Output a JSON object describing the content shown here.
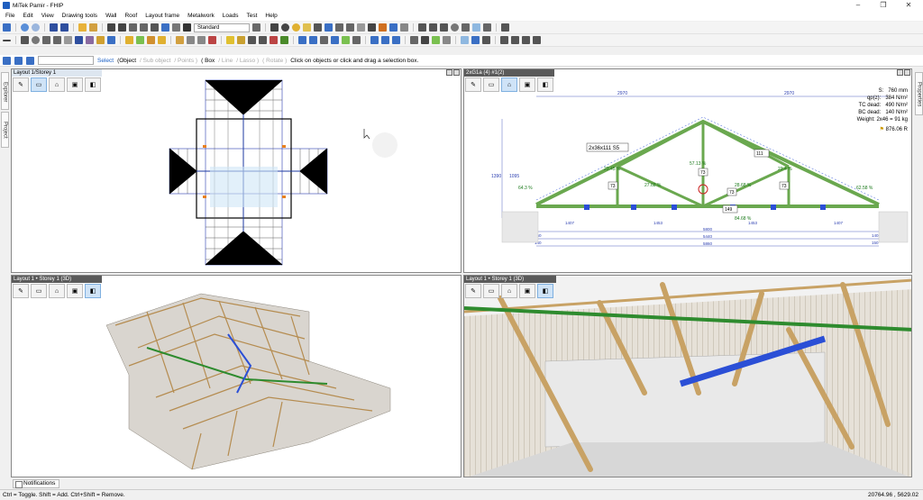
{
  "window": {
    "title": "MiTek Pamir - FHIP",
    "minimize": "–",
    "maximize": "❐",
    "close": "✕"
  },
  "menu": [
    "File",
    "Edit",
    "View",
    "Drawing tools",
    "Wall",
    "Roof",
    "Layout frame",
    "Metalwork",
    "Loads",
    "Test",
    "Help"
  ],
  "toolbar": {
    "style_dropdown": "Standard"
  },
  "selection_bar": {
    "select": "Select",
    "object": "Object",
    "sub_object": "Sub object",
    "points": "Points",
    "box": "Box",
    "line": "Line",
    "lasso": "Lasso",
    "rotate": "Rotate",
    "hint": "Click on objects or click and drag a selection box."
  },
  "side_tabs": {
    "explorer": "Explorer",
    "project": "Project",
    "properties": "Properties"
  },
  "viewports": {
    "plan": {
      "title": "Layout 1/Storey 1"
    },
    "truss": {
      "title": "2xG1a (4) #1(2)",
      "props": [
        {
          "label": "S:",
          "value": "760 mm"
        },
        {
          "label": "qp(z):",
          "value": "384 N/m²"
        },
        {
          "label": "TC dead:",
          "value": "490 N/m²"
        },
        {
          "label": "BC dead:",
          "value": "140 N/m²"
        },
        {
          "label": "Weight:",
          "value": "2x46 = 91 kg"
        }
      ],
      "price": "876.06 R",
      "member_label": "2x36x111 S5",
      "top_dims": [
        "2970",
        "2970"
      ],
      "height_dims": [
        "1390",
        "1095"
      ],
      "percentages": [
        "64.3 %",
        "23.45 %",
        "27.68 %",
        "57.13 %",
        "28.68 %",
        "23.4 %",
        "62.58 %",
        "84.68 %"
      ],
      "plate_tags": [
        "73",
        "73",
        "73",
        "73",
        "149",
        "111"
      ],
      "bottom_dims": [
        "1407",
        "1453",
        "1453",
        "1407"
      ],
      "overall_dims": [
        "5800",
        "5440",
        "5860"
      ],
      "end_dims": [
        "150",
        "140",
        "140",
        "150"
      ]
    },
    "iso": {
      "title": "Layout 1 • Storey 1 (3D)"
    },
    "persp": {
      "title": "Layout 1 • Storey 1 (3D)"
    }
  },
  "notifications": "Notifications",
  "status": {
    "hint": "Ctrl = Toggle. Shift = Add. Ctrl+Shift = Remove.",
    "coords": "20764.96 , 5629.02"
  },
  "colors": {
    "timber": "#c8a265",
    "green_member": "#2e8b2e",
    "blue_member": "#2b4fd6",
    "wall": "#d9d9d9",
    "selection": "#cfe3f7"
  }
}
